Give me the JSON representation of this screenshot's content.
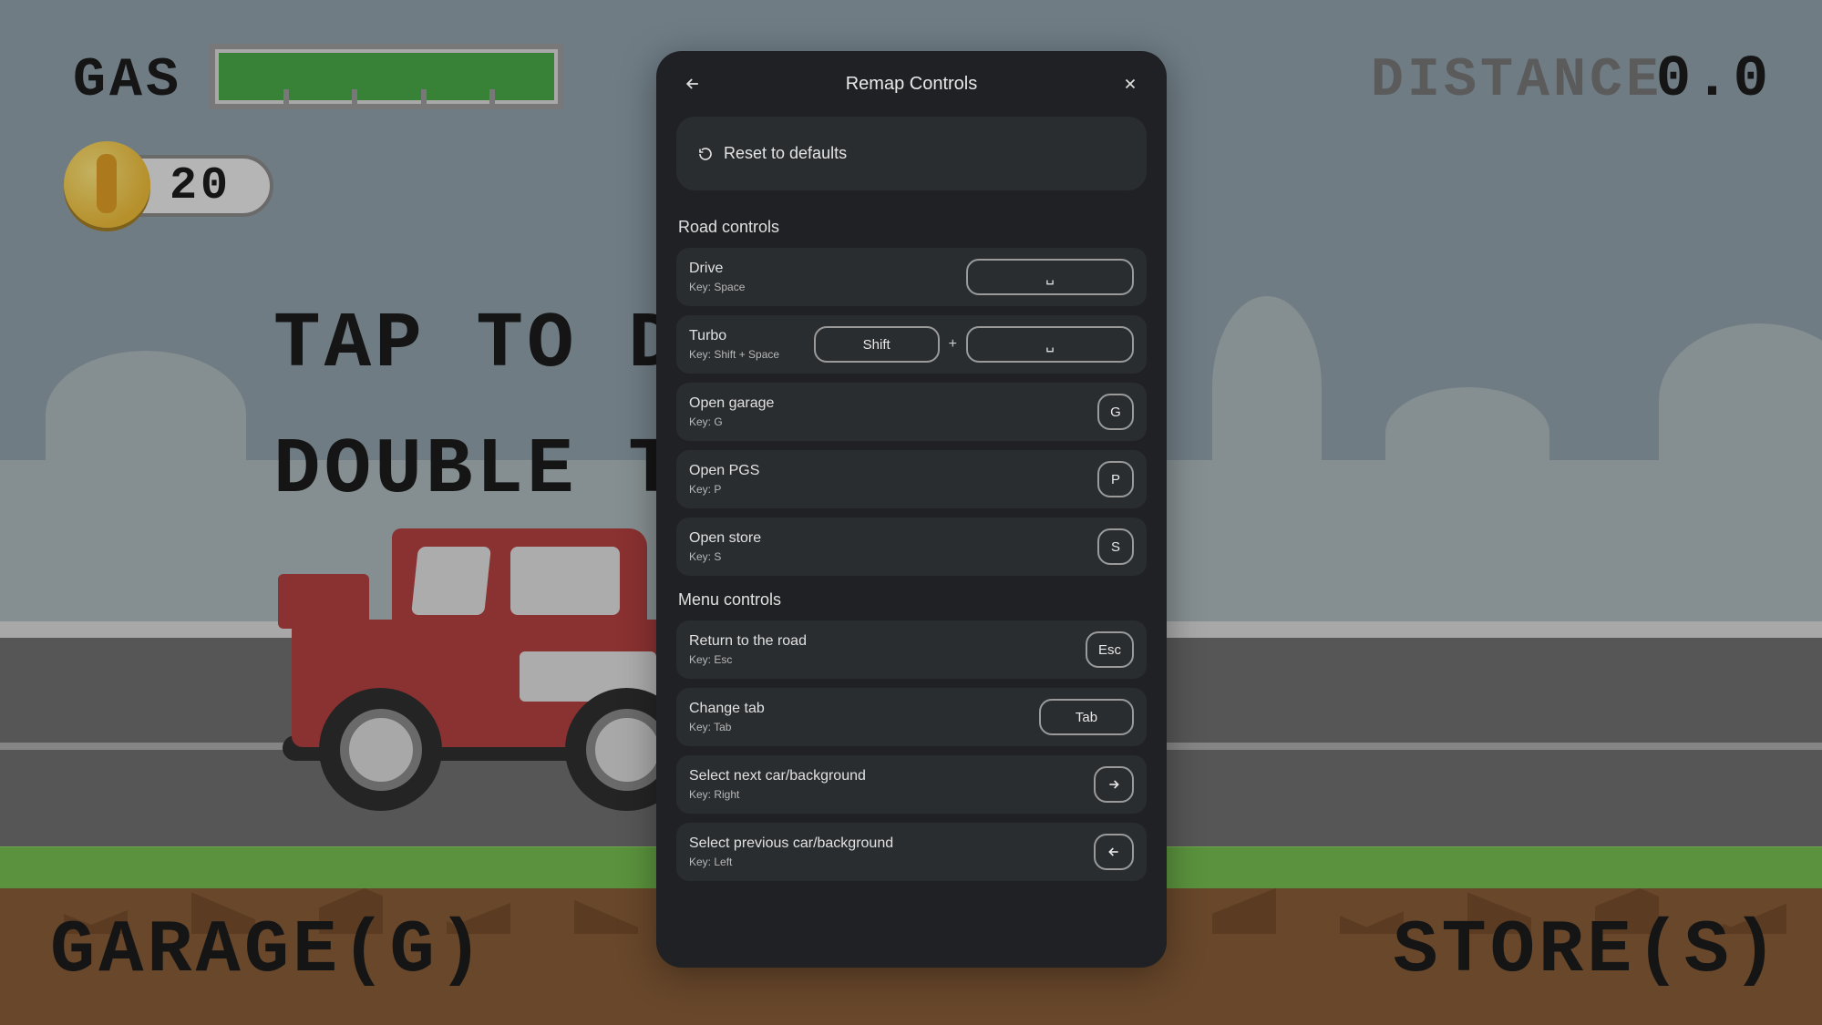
{
  "hud": {
    "gas_label": "GAS",
    "distance_label": "DISTANCE",
    "distance_value": "0.0",
    "coins": "20",
    "tap_line1": "TAP TO D",
    "tap_line2": "DOUBLE TAP",
    "garage_label": "GARAGE(G)",
    "store_label": "STORE(S)"
  },
  "modal": {
    "title": "Remap Controls",
    "reset_label": "Reset to defaults",
    "plus": "+",
    "sections": {
      "road": {
        "title": "Road controls",
        "drive": {
          "label": "Drive",
          "sub": "Key: Space",
          "key": "␣"
        },
        "turbo": {
          "label": "Turbo",
          "sub": "Key: Shift + Space",
          "key1": "Shift",
          "key2": "␣"
        },
        "garage": {
          "label": "Open garage",
          "sub": "Key: G",
          "key": "G"
        },
        "pgs": {
          "label": "Open PGS",
          "sub": "Key: P",
          "key": "P"
        },
        "store": {
          "label": "Open store",
          "sub": "Key: S",
          "key": "S"
        }
      },
      "menu": {
        "title": "Menu controls",
        "return": {
          "label": "Return to the road",
          "sub": "Key: Esc",
          "key": "Esc"
        },
        "chtab": {
          "label": "Change tab",
          "sub": "Key: Tab",
          "key": "Tab"
        },
        "next": {
          "label": "Select next car/background",
          "sub": "Key: Right"
        },
        "prev": {
          "label": "Select previous car/background",
          "sub": "Key: Left"
        }
      }
    }
  }
}
